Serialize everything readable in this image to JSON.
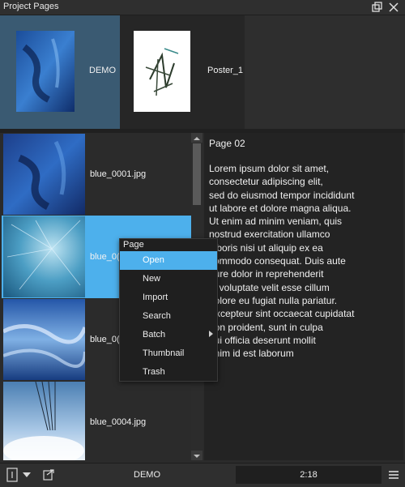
{
  "window": {
    "title": "Project Pages"
  },
  "projects": [
    {
      "name": "DEMO",
      "selected": true
    },
    {
      "name": "Poster_1",
      "selected": false
    }
  ],
  "pages": [
    {
      "file": "blue_0001.jpg"
    },
    {
      "file": "blue_0002.jpg",
      "visible_label": "blue_0(",
      "selected": true
    },
    {
      "file": "blue_0003.jpg",
      "visible_label": "blue_0("
    },
    {
      "file": "blue_0004.jpg"
    }
  ],
  "text_pane": {
    "page_title": "Page 02",
    "body": "Lorem ipsum dolor sit amet,\nconsectetur adipiscing elit,\nsed do eiusmod tempor incididunt\nut labore et dolore magna aliqua.\nUt enim ad minim veniam, quis\nnostrud exercitation ullamco\nlaboris nisi ut aliquip ex ea\ncommodo consequat. Duis aute\nirure dolor in reprehenderit\nin voluptate velit esse cillum\ndolore eu fugiat nulla pariatur.\nExcepteur sint occaecat cupidatat\nnon proident, sunt in culpa\nqui officia deserunt mollit\nanim id est laborum"
  },
  "context_menu": {
    "title": "Page",
    "items": [
      {
        "label": "Open",
        "highlighted": true
      },
      {
        "label": "New"
      },
      {
        "label": "Import"
      },
      {
        "label": "Search"
      },
      {
        "label": "Batch",
        "has_submenu": true
      },
      {
        "label": "Thumbnail"
      },
      {
        "label": "Trash"
      }
    ]
  },
  "footer": {
    "project_name": "DEMO",
    "counter": "2:18"
  },
  "colors": {
    "accent": "#4db0ec",
    "selected_project": "#3a5a72",
    "background": "#2b2b2b"
  },
  "icons": [
    "restore-icon",
    "close-icon",
    "page-view-icon",
    "dropdown-icon",
    "export-icon",
    "hamburger-menu-icon",
    "scroll-up-icon",
    "scroll-down-icon",
    "submenu-arrow-icon"
  ]
}
